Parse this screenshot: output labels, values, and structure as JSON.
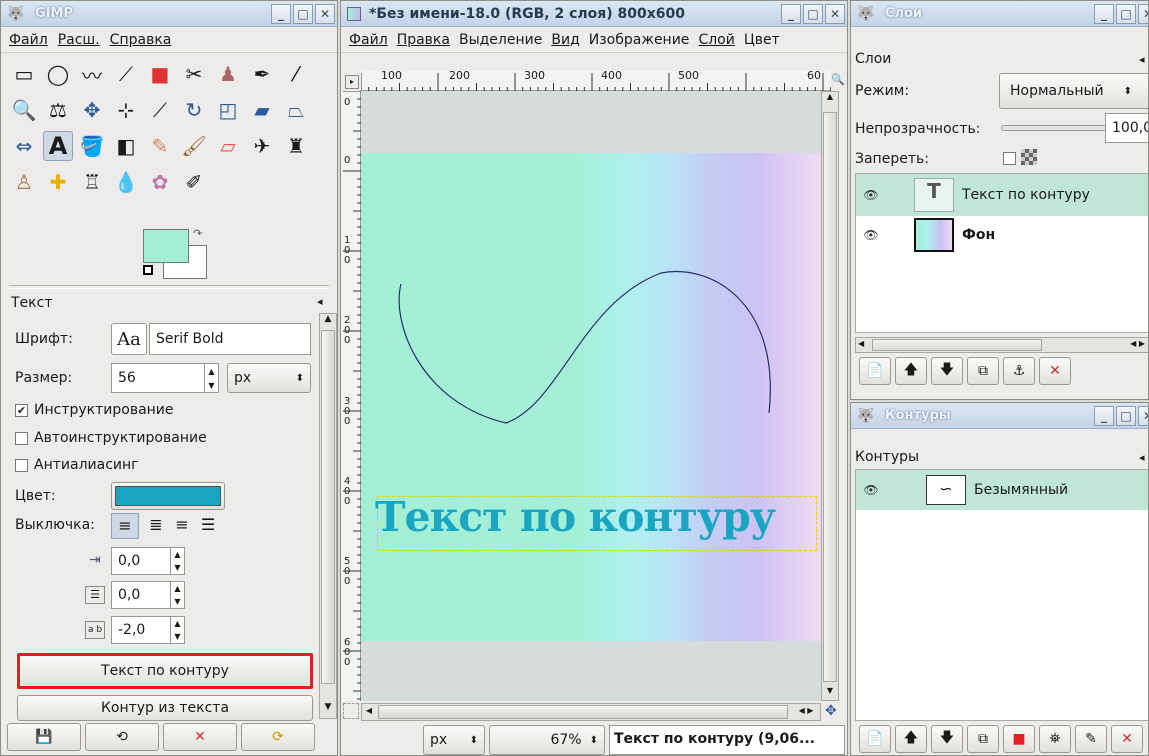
{
  "toolbox": {
    "title": "GIMP",
    "menu": [
      "Файл",
      "Расш.",
      "Справка"
    ],
    "tool_icons": [
      "rect-select",
      "ellipse-select",
      "free-select",
      "fuzzy-select",
      "color-select",
      "scissors",
      "foreground-select",
      "paths",
      "color-picker",
      "zoom",
      "measure",
      "move",
      "align",
      "crop",
      "rotate",
      "scale",
      "shear",
      "perspective",
      "flip",
      "text",
      "bucket-fill",
      "blend",
      "pencil",
      "paintbrush",
      "eraser",
      "airbrush",
      "ink",
      "clone",
      "heal",
      "perspective-clone",
      "smudge",
      "dodge-burn",
      "convolve"
    ],
    "fg_color": "#a3f0d7",
    "bg_color": "#ffffff",
    "options_title": "Текст",
    "font_label": "Шрифт:",
    "font_preview": "Aa",
    "font_value": "Serif Bold",
    "size_label": "Размер:",
    "size_value": "56",
    "size_unit": "px",
    "hinting": "Инструктирование",
    "autohint": "Автоинструктирование",
    "antialias": "Антиалиасинг",
    "color_label": "Цвет:",
    "text_color": "#1aa6c2",
    "justify_label": "Выключка:",
    "indent_value": "0,0",
    "line_spacing_value": "0,0",
    "letter_spacing_value": "-2,0",
    "text_along_path_btn": "Текст по контуру",
    "path_from_text_btn": "Контур из текста"
  },
  "image_window": {
    "title": "*Без имени-18.0 (RGB, 2 слоя) 800x600",
    "menu": [
      "Файл",
      "Правка",
      "Выделение",
      "Вид",
      "Изображение",
      "Слой",
      "Цвет"
    ],
    "ruler_h": [
      "100",
      "200",
      "300",
      "400",
      "500",
      "60"
    ],
    "ruler_v": [
      "0",
      "100",
      "200",
      "300",
      "400",
      "500",
      "600"
    ],
    "canvas_text": "Текст по контуру",
    "unit": "px",
    "zoom": "67%",
    "status": "Текст по контуру (9,06..."
  },
  "layers": {
    "title": "Слои",
    "tab": "Слои",
    "mode_label": "Режим:",
    "mode_value": "Нормальный",
    "opacity_label": "Непрозрачность:",
    "opacity_value": "100,0",
    "lock_label": "Запереть:",
    "items": [
      {
        "name": "Текст по контуру"
      },
      {
        "name": "Фон"
      }
    ]
  },
  "paths": {
    "title": "Контуры",
    "tab": "Контуры",
    "items": [
      {
        "name": "Безымянный"
      }
    ]
  },
  "colors": {
    "highlight": "#bfe6d6",
    "red_frame": "#e32020",
    "title_bg": "#c6d6e8"
  }
}
